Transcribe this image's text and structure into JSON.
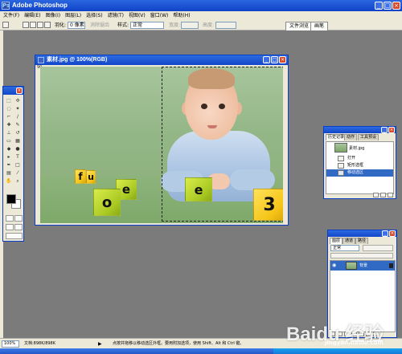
{
  "app": {
    "title": "Adobe Photoshop"
  },
  "menu": [
    "文件(F)",
    "编辑(E)",
    "图像(I)",
    "图层(L)",
    "选择(S)",
    "滤镜(T)",
    "视图(V)",
    "窗口(W)",
    "帮助(H)"
  ],
  "options_bar": {
    "feather_label": "羽化:",
    "feather_value": "0 像素",
    "antialias_label": "消除锯齿",
    "style_label": "样式:",
    "style_value": "正常",
    "width_label": "宽度:",
    "height_label": "高度:",
    "tabs": [
      "文件浏览",
      "画笔"
    ]
  },
  "document": {
    "title": "素材.jpg @ 100%(RGB)",
    "ruler_mark": "90"
  },
  "blocks": [
    {
      "letter": "f",
      "color": "yellow"
    },
    {
      "letter": "u",
      "color": "yellow"
    },
    {
      "letter": "e",
      "color": "green"
    },
    {
      "letter": "e",
      "color": "green"
    },
    {
      "letter": "o",
      "color": "green"
    },
    {
      "letter": "3",
      "color": "yellow"
    }
  ],
  "history": {
    "tabs": [
      "历史记录",
      "动作",
      "工具预设"
    ],
    "snapshot_label": "素材.jpg",
    "items": [
      "打开",
      "矩形选框",
      "移动选区"
    ],
    "selected_index": 2
  },
  "layers": {
    "tabs": [
      "图层",
      "通道",
      "路径"
    ],
    "blend_mode": "正常",
    "layer_name": "背景"
  },
  "status": {
    "zoom": "100%",
    "doc_size": "文档:898K/898K",
    "hint": "点按并拖移以移动选区外框。要用附加选项，使用 Shift、Alt 和 Ctrl 键。"
  },
  "watermark": {
    "brand": "Baidu 经验",
    "url": "jingyan.baidu.com"
  },
  "colors": {
    "title_blue": "#0f43c8",
    "chrome": "#ece9d8",
    "workspace": "#7b7b7b",
    "selection": "#316ac5"
  },
  "icons": [
    "photoshop-icon",
    "minimize-icon",
    "maximize-icon",
    "close-icon",
    "eye-icon",
    "lock-icon",
    "move-tool-icon",
    "marquee-tool-icon"
  ]
}
